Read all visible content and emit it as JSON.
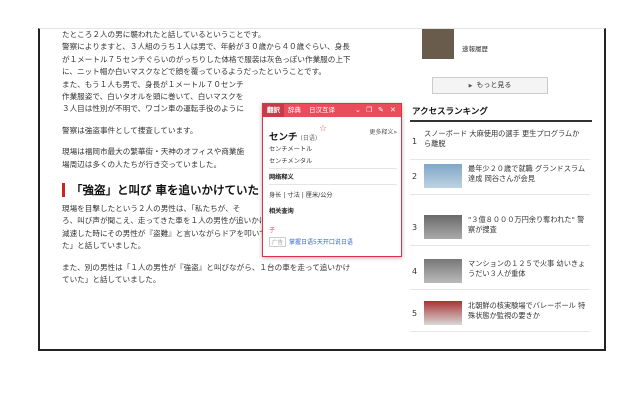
{
  "article": {
    "lines": [
      "たところ２人の男に襲われたと話しているということです。",
      "警察によりますと、３人組のうち１人は男で、年齢が３０歳から４０歳ぐらい、身長",
      "が１メートル７５センチぐらいのがっちりした体格で服装は灰色っぽい作業服の上下",
      "に、ニット帽か白いマスクなどで顔を覆っているようだったということです。",
      "また、もう１人も男で、身長が１メートル７０センチ",
      "作業服姿で、白いタオルを頭に巻いて、白いマスクを",
      "３人目は性別が不明で、ワゴン車の運転手役のように"
    ],
    "para2": "警察は強盗事件として捜査しています。",
    "para3_line1": "現場は福岡市最大の繁華街・天神のオフィスや商業施",
    "para3_line2": "場周辺は多くの人たちが行き交っていました。",
    "heading": "「強盗」と叫び 車を追いかけていた",
    "para4_line1": "現場を目撃したという２人の男性は、「私たちが、そ",
    "para4_line2": "ろ、叫び声が聞こえ、走ってきた車を１人の男性が追いかけていた。車が曲がり角で",
    "para4_line3": "減速した時にその男性が『盗難』と言いながらドアを叩いていたが、車は走っていっ",
    "para4_line4": "た」と話していました。",
    "para5_line1": "また、別の男性は「１人の男性が『強盗』と叫びながら、１台の車を走って追いかけ",
    "para5_line2": "ていた」と話していました。"
  },
  "sidebar": {
    "top_caption": "速報履歴",
    "more_button": "もっと見る",
    "ranking_title": "アクセスランキング",
    "ranking": [
      {
        "num": "1",
        "text": "スノーボード 大麻使用の選手 更生プログラムから離脱",
        "thumb": ""
      },
      {
        "num": "2",
        "text": "最年少２０歳で就職 グランドスラム達成 岡谷さんが会見",
        "thumb": "sky"
      },
      {
        "num": "3",
        "text": "\"３億８０００万円余り奪われた\" 警察が捜査",
        "thumb": "street"
      },
      {
        "num": "4",
        "text": "マンションの１２５で火事 幼いきょうだい３人が重体",
        "thumb": "mono"
      },
      {
        "num": "5",
        "text": "北朝鮮の核実験場でバレーボール 特殊状態か監視の要きか",
        "thumb": "red"
      }
    ]
  },
  "popup": {
    "tabs": [
      "翻訳",
      "辞典",
      "日汉互译"
    ],
    "word": "センチ",
    "reading": "(日语)",
    "detail": "更多释义»",
    "entries": [
      "センチメートル",
      "センチメンタル"
    ],
    "section1": "网络释义",
    "meanings": "身长 | 寸法 | 厘米/公分",
    "section2": "相关查询",
    "hint": "子",
    "ad_label": "广告",
    "footer_link": "掌握日语5天开口说日语"
  },
  "colors": {
    "popup_accent": "#e94d5b",
    "heading_bar": "#cc2222",
    "frame_border": "#222222"
  }
}
